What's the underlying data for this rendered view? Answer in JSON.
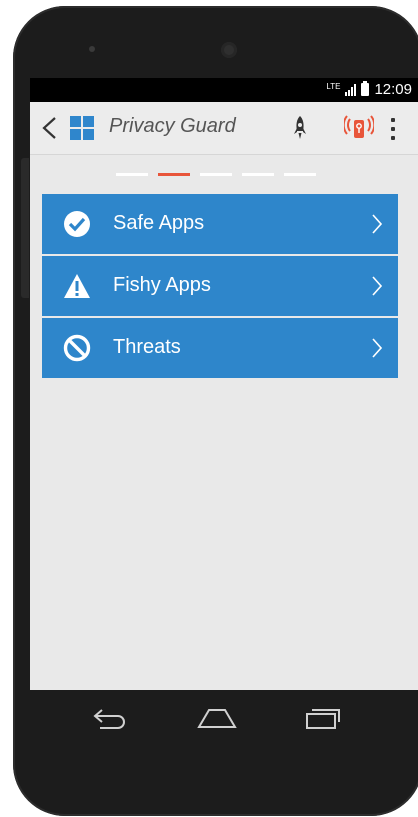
{
  "status_bar": {
    "network": "LTE",
    "time": "12:09"
  },
  "app_bar": {
    "title": "Privacy Guard",
    "icons": [
      "back-chevron-icon",
      "app-grid-logo-icon",
      "rocket-icon",
      "device-alert-icon",
      "overflow-menu-icon"
    ]
  },
  "pager": {
    "total": 5,
    "active": 2
  },
  "menu": {
    "items": [
      {
        "label": "Safe Apps",
        "icon": "check-circle-icon"
      },
      {
        "label": "Fishy Apps",
        "icon": "warning-triangle-icon"
      },
      {
        "label": "Threats",
        "icon": "prohibited-icon"
      }
    ]
  },
  "navigation": {
    "buttons": [
      "back-icon",
      "home-icon",
      "recent-apps-icon"
    ]
  },
  "colors": {
    "accent_blue": "#2e86cb",
    "alert_orange": "#e8553a",
    "screen_background": "#e9e9e9"
  }
}
